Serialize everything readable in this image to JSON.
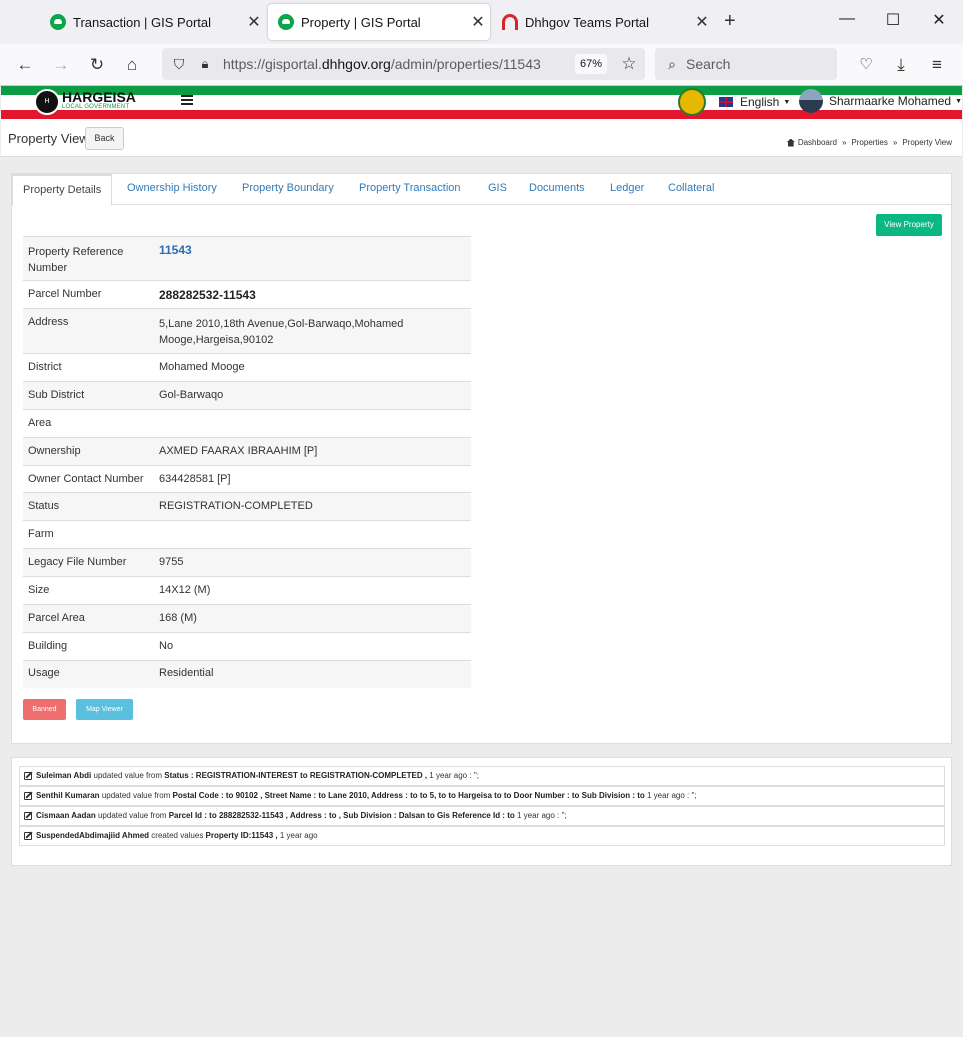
{
  "browser": {
    "tabs": [
      {
        "title": "Transaction | GIS Portal",
        "icon": "gis-portal-icon",
        "active": false
      },
      {
        "title": "Property | GIS Portal",
        "icon": "gis-portal-icon",
        "active": true
      },
      {
        "title": "Dhhgov Teams Portal",
        "icon": "teams-icon",
        "active": false
      }
    ],
    "url_prefix": "https://gisportal.",
    "url_domain": "dhhgov.org",
    "url_path": "/admin/properties/11543",
    "zoom": "67%",
    "search_placeholder": "Search"
  },
  "header": {
    "brand_name": "HARGEISA",
    "brand_sub": "LOCAL GOVERNMENT",
    "language": "English",
    "user_name": "Sharmaarke Mohamed",
    "colors": {
      "green": "#0c9c43",
      "red": "#e3162d"
    }
  },
  "page": {
    "title": "Property View",
    "back_label": "Back",
    "breadcrumb": [
      "Dashboard",
      "Properties",
      "Property View"
    ]
  },
  "tabs": [
    "Property Details",
    "Ownership History",
    "Property Boundary",
    "Property Transaction",
    "GIS",
    "Documents",
    "Ledger",
    "Collateral"
  ],
  "view_property_label": "View Property",
  "details": [
    {
      "label": "Property Reference Number",
      "value": "11543"
    },
    {
      "label": "Parcel Number",
      "value": "288282532-11543"
    },
    {
      "label": "Address",
      "value": "5,Lane 2010,18th Avenue,Gol-Barwaqo,Mohamed Mooge,Hargeisa,90102"
    },
    {
      "label": "District",
      "value": "Mohamed Mooge"
    },
    {
      "label": "Sub District",
      "value": "Gol-Barwaqo"
    },
    {
      "label": "Area",
      "value": ""
    },
    {
      "label": "Ownership",
      "value": "AXMED FAARAX IBRAAHIM [P]"
    },
    {
      "label": "Owner Contact Number",
      "value": "634428581 [P]"
    },
    {
      "label": "Status",
      "value": "REGISTRATION-COMPLETED"
    },
    {
      "label": "Farm",
      "value": ""
    },
    {
      "label": "Legacy File Number",
      "value": "9755"
    },
    {
      "label": "Size",
      "value": "14X12 (M)"
    },
    {
      "label": "Parcel Area",
      "value": "168 (M)"
    },
    {
      "label": "Building",
      "value": "No"
    },
    {
      "label": "Usage",
      "value": "Residential"
    }
  ],
  "actions": {
    "banned_label": "Banned",
    "map_viewer_label": "Map Viewer"
  },
  "log": [
    {
      "user": "Suleiman Abdi",
      "verb": "updated value from",
      "detail": "Status : REGISTRATION-INTEREST to REGISTRATION-COMPLETED ,",
      "time": "1 year ago : '';"
    },
    {
      "user": "Senthil Kumaran",
      "verb": "updated value from",
      "detail": "Postal Code : to 90102 , Street Name : to Lane 2010, Address : to to 5, to to Hargeisa to to Door Number : to Sub Division : to",
      "time": "1 year ago : '';"
    },
    {
      "user": "Cismaan Aadan",
      "verb": "updated value from",
      "detail": "Parcel Id : to 288282532-11543 , Address : to , Sub Division : Dalsan to Gis Reference Id : to",
      "time": "1 year ago : '';"
    },
    {
      "user": "SuspendedAbdimajiid Ahmed",
      "verb": "created values",
      "detail": "Property ID:11543 ,",
      "time": "1 year ago"
    }
  ]
}
